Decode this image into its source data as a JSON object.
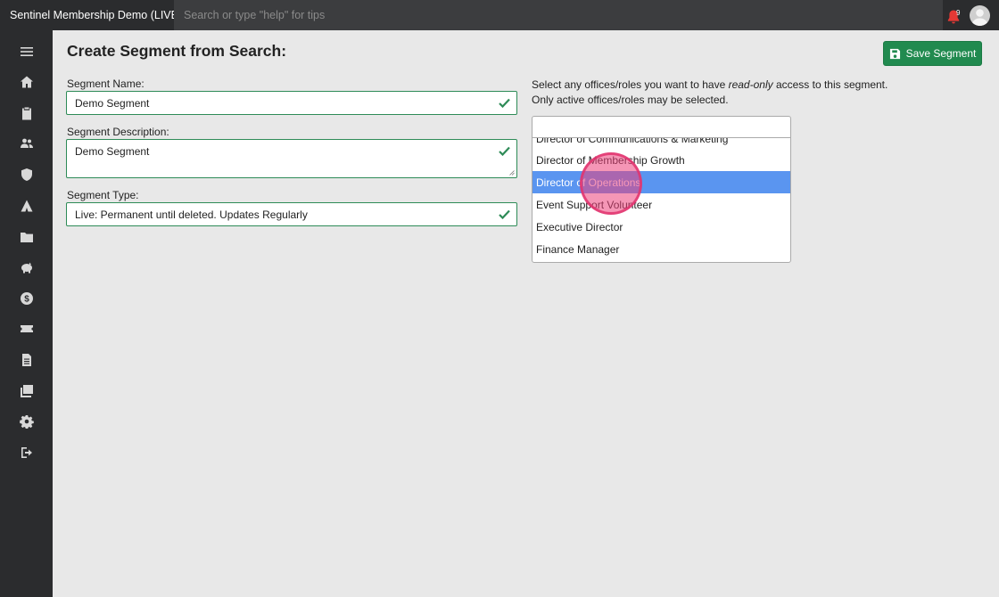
{
  "app": {
    "title": "Sentinel Membership Demo (LIVE)",
    "search_placeholder": "Search or type \"help\" for tips",
    "notification_count": "9"
  },
  "sidebar": {
    "items": [
      {
        "icon": "menu-icon"
      },
      {
        "icon": "home-icon"
      },
      {
        "icon": "clipboard-icon"
      },
      {
        "icon": "users-icon"
      },
      {
        "icon": "shield-icon"
      },
      {
        "icon": "campground-icon"
      },
      {
        "icon": "folder-icon"
      },
      {
        "icon": "piggy-bank-icon"
      },
      {
        "icon": "dollar-icon"
      },
      {
        "icon": "ticket-icon"
      },
      {
        "icon": "document-icon"
      },
      {
        "icon": "images-icon"
      },
      {
        "icon": "gear-icon"
      },
      {
        "icon": "sign-out-icon"
      }
    ]
  },
  "main": {
    "title": "Create Segment from Search:",
    "save_label": "Save Segment",
    "fields": {
      "name_label": "Segment Name:",
      "name_value": "Demo Segment",
      "description_label": "Segment Description:",
      "description_value": "Demo Segment",
      "type_label": "Segment Type:",
      "type_value": "Live: Permanent until deleted. Updates Regularly"
    },
    "access": {
      "line1_prefix": "Select any offices/roles you want to have ",
      "line1_emphasis": "read-only",
      "line1_suffix": " access to this segment.",
      "line2": "Only active offices/roles may be selected."
    },
    "roles": {
      "search_value": "",
      "options": [
        "Director of Communications & Marketing",
        "Director of Membership Growth",
        "Director of Operations",
        "Event Support Volunteer",
        "Executive Director",
        "Finance Manager"
      ],
      "selected": "Director of Operations"
    }
  },
  "colors": {
    "topbar": "#2b2c2e",
    "accent_green": "#218a4f",
    "selected_blue": "#5a95f0",
    "click_indicator": "#ec407a",
    "alert_red": "#e53935"
  }
}
